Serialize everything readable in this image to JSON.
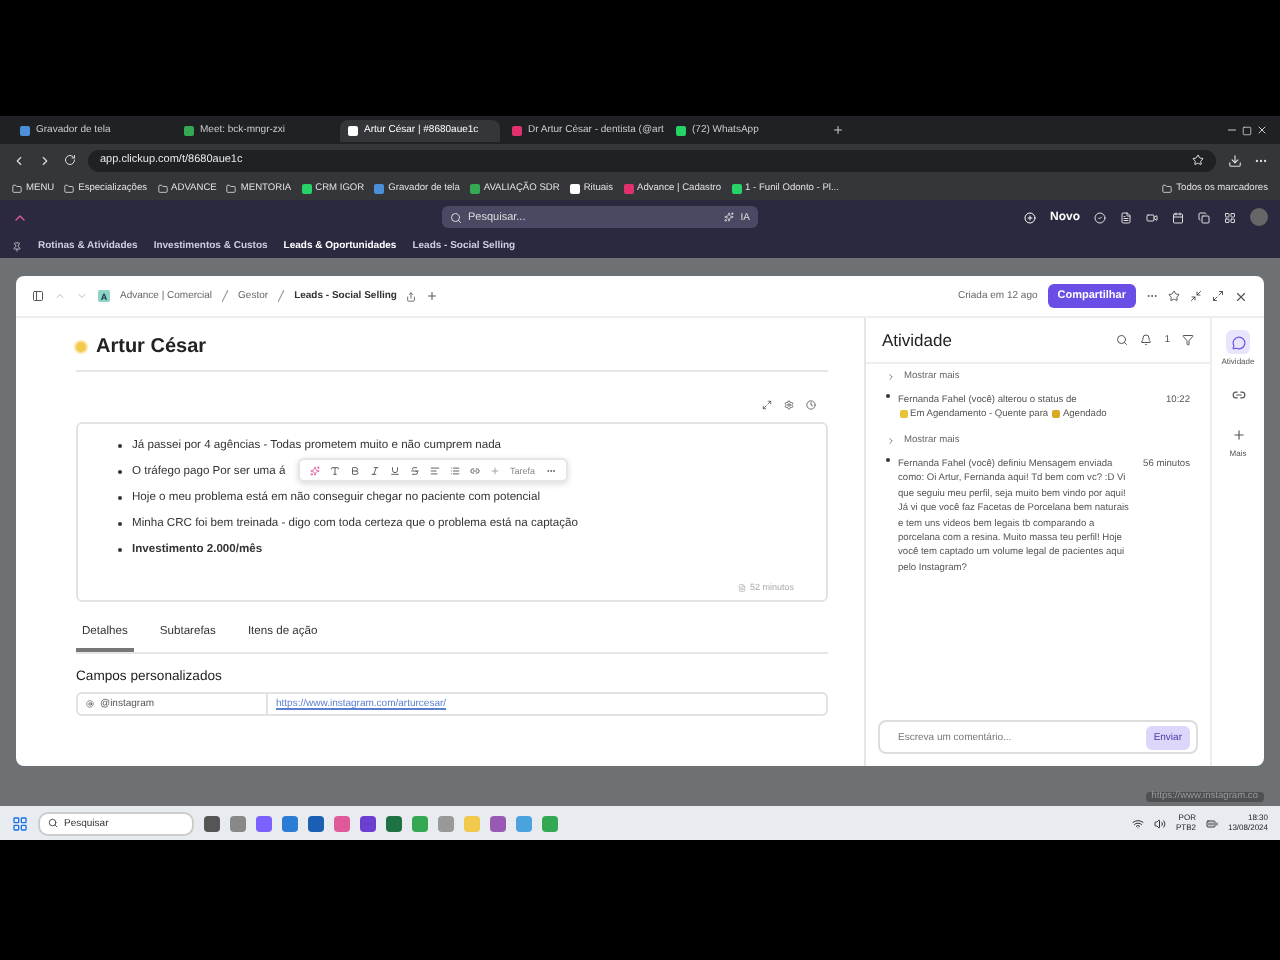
{
  "browser": {
    "tabs": [
      {
        "title": "Gravador de tela",
        "selected": false
      },
      {
        "title": "Meet: bck-mngr-zxi",
        "selected": false
      },
      {
        "title": "Artur César | #8680aue1c",
        "selected": true
      },
      {
        "title": "Dr Artur César - dentista (@art",
        "selected": false
      },
      {
        "title": "(72) WhatsApp",
        "selected": false
      }
    ],
    "address": "app.clickup.com/t/8680aue1c",
    "bookmarks": [
      {
        "label": "MENU",
        "kind": "folder"
      },
      {
        "label": "Especializações",
        "kind": "folder"
      },
      {
        "label": "ADVANCE",
        "kind": "folder"
      },
      {
        "label": "MENTORIA",
        "kind": "folder"
      },
      {
        "label": "CRM IGOR",
        "kind": "link"
      },
      {
        "label": "Gravador de tela",
        "kind": "link"
      },
      {
        "label": "AVALIAÇÃO SDR",
        "kind": "link"
      },
      {
        "label": "Rituais",
        "kind": "link"
      },
      {
        "label": "Advance | Cadastro",
        "kind": "link"
      },
      {
        "label": "1 - Funil Odonto - Pl...",
        "kind": "link"
      }
    ],
    "all_bookmarks": "Todos os marcadores"
  },
  "app": {
    "search": {
      "placeholder": "Pesquisar..."
    },
    "ai": "IA",
    "new_button": "Novo",
    "nav": [
      {
        "label": "Rotinas & Atividades",
        "selected": false
      },
      {
        "label": "Investimentos & Custos",
        "selected": false
      },
      {
        "label": "Leads & Oportunidades",
        "selected": true
      },
      {
        "label": "Leads - Social Selling",
        "selected": false
      }
    ]
  },
  "task": {
    "breadcrumbs": [
      "Advance | Comercial",
      "Gestor",
      "Leads - Social Selling"
    ],
    "workspace_badge": "A",
    "created": "Criada em 12 ago",
    "share": "Compartilhar",
    "title": "Artur César",
    "notes": [
      {
        "text": "Já passei por 4 agências - Todas prometem muito e não cumprem nada",
        "bold": false
      },
      {
        "text": "O tráfego pago Por ser uma á",
        "bold": false
      },
      {
        "text": "Hoje o meu problema está em não conseguir chegar no paciente com potencial",
        "bold": false
      },
      {
        "text": "Minha CRC foi bem treinada - digo com toda certeza que o problema está na captação",
        "bold": false
      },
      {
        "text": "Investimento 2.000/mês",
        "bold": true
      }
    ],
    "format_toolbar": {
      "task": "Tarefa"
    },
    "duration": "52 minutos",
    "tabs": [
      {
        "label": "Detalhes",
        "selected": true
      },
      {
        "label": "Subtarefas",
        "selected": false
      },
      {
        "label": "Itens de ação",
        "selected": false
      }
    ],
    "section": "Campos personalizados",
    "field": {
      "label": "@instagram",
      "value": "https://www.instagram.com/arturcesar/"
    }
  },
  "activity": {
    "title": "Atividade",
    "notifications": "1",
    "entries": [
      {
        "kind": "more",
        "text": "Mostrar mais"
      },
      {
        "kind": "status",
        "text": "Fernanda Fahel (você) alterou o status de",
        "statuses": [
          {
            "label": "Em Agendamento - Quente",
            "color": "#e8c33a"
          },
          {
            "label": "Agendado",
            "color": "#d9a826"
          }
        ],
        "joiner": "para",
        "time": "10:22"
      },
      {
        "kind": "more",
        "text": "Mostrar mais"
      },
      {
        "kind": "message",
        "text": "Fernanda Fahel (você) definiu Mensagem enviada como: Oi Artur, Fernanda aqui! Td bem com vc? :D Vi que seguiu meu perfil, seja muito bem vindo por aqui! Já vi que você faz Facetas de Porcelana bem naturais e tem uns videos bem legais tb comparando a porcelana com a resina. Muito massa teu perfil! Hoje você tem captado um volume legal de pacientes aqui pelo Instagram?",
        "time": "56 minutos"
      }
    ],
    "comment": {
      "placeholder": "Escreva um comentário...",
      "send": "Enviar",
      "disabled": true
    },
    "rail": [
      {
        "label": "Atividade",
        "kind": "activity",
        "selected": true
      },
      {
        "kind": "link",
        "selected": false
      },
      {
        "label": "Mais",
        "kind": "more",
        "selected": false
      }
    ]
  },
  "taskbar": {
    "search": {
      "placeholder": "Pesquisar"
    },
    "language": "POR",
    "layout": "PTB2",
    "time": "18:30",
    "date": "13/08/2024"
  },
  "link_preview": "https://www.instagram.co"
}
